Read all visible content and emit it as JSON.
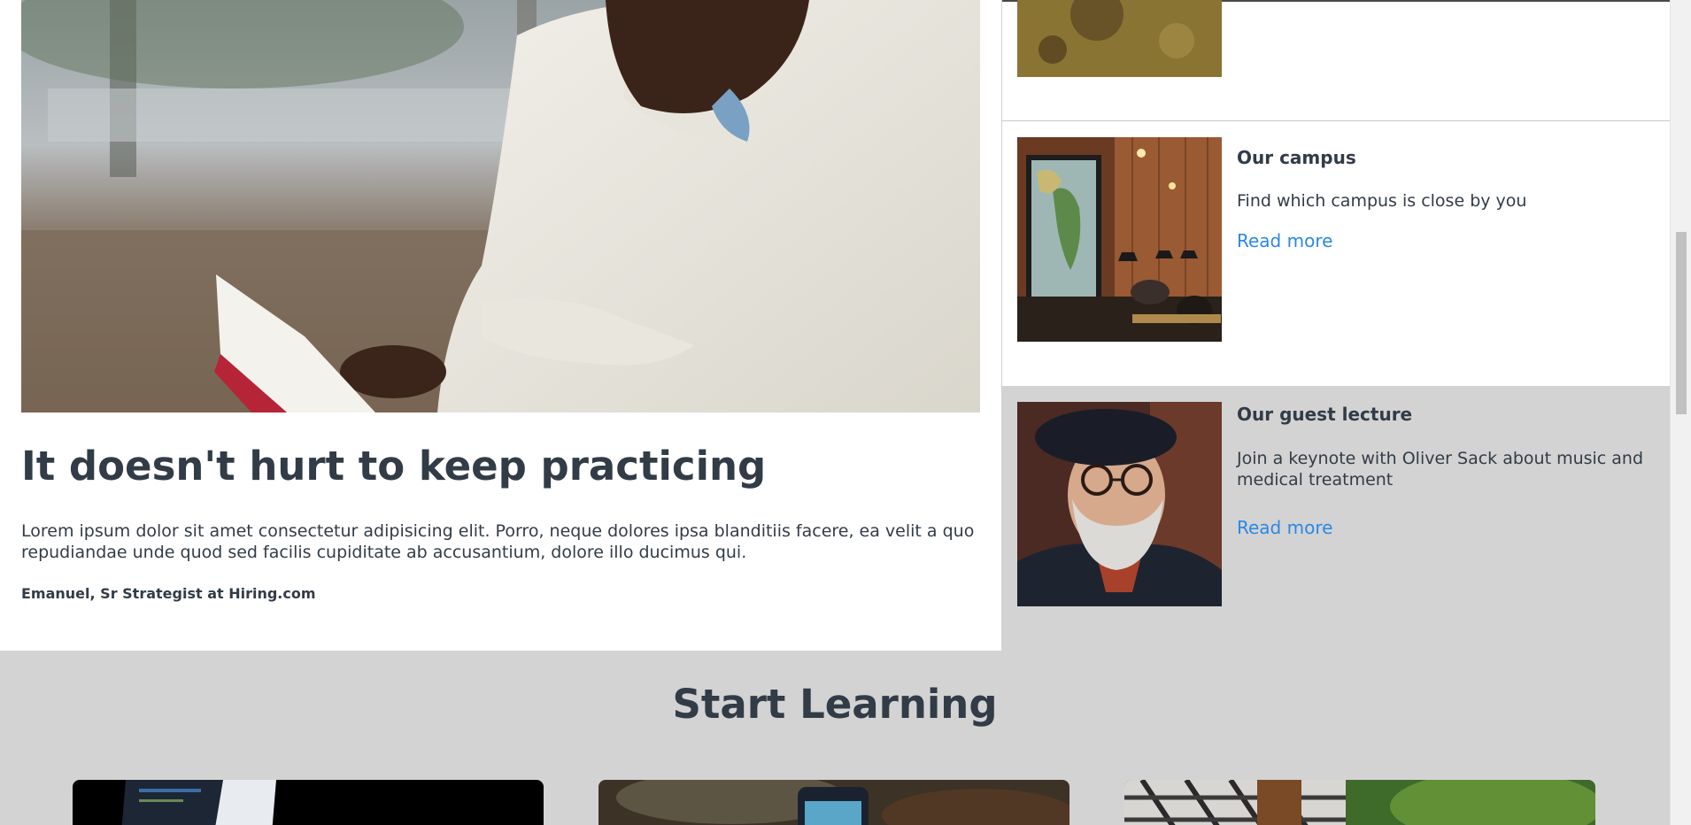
{
  "featured": {
    "title": "It doesn't hurt to keep practicing",
    "body": "Lorem ipsum dolor sit amet consectetur adipisicing elit. Porro, neque dolores ipsa blanditiis facere, ea velit a quo repudiandae unde quod sed facilis cupiditate ab accusantium, dolore illo ducimus qui.",
    "author": "Emanuel, Sr Strategist at Hiring.com"
  },
  "side_items": [
    {
      "title": "",
      "text": "",
      "link": ""
    },
    {
      "title": "Our campus",
      "text": "Find which campus is close by you",
      "link": "Read more"
    },
    {
      "title": "Our guest lecture",
      "text": "Join a keynote with Oliver Sack about music and medical treatment",
      "link": "Read more"
    }
  ],
  "learning": {
    "title": "Start Learning"
  },
  "colors": {
    "text": "#323c47",
    "link": "#2a88e6",
    "section_bg": "#d3d3d3"
  }
}
